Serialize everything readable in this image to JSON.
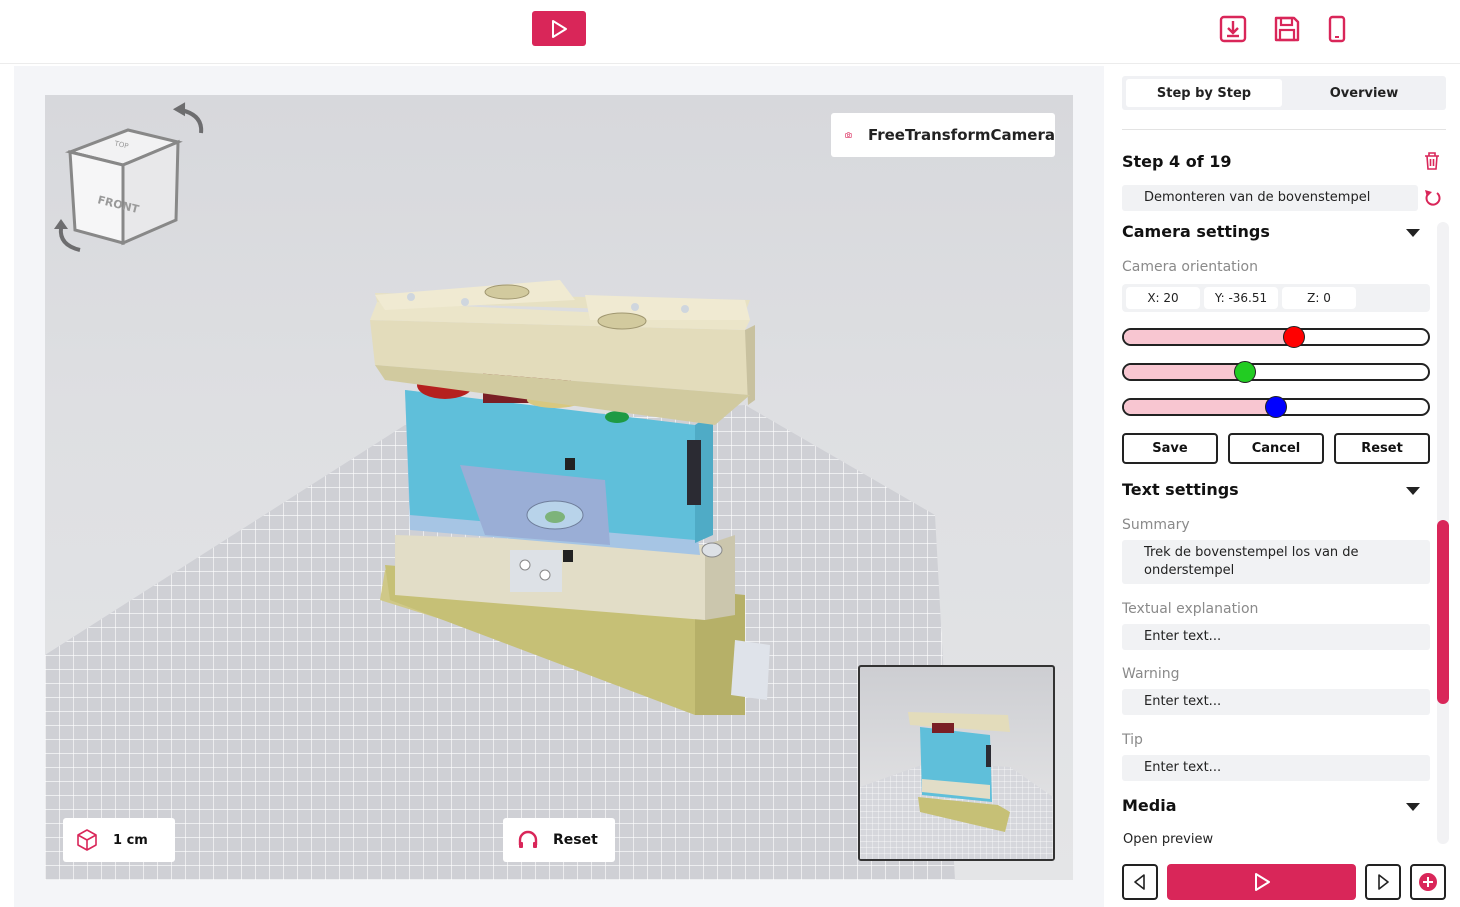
{
  "colors": {
    "accent": "#d92659",
    "slider_fill": "#f8c6d1",
    "knob_x": "#ff0000",
    "knob_y": "#22cc22",
    "knob_z": "#0000ff"
  },
  "topbar": {
    "play_icon": "play-icon",
    "download_icon": "download-icon",
    "save_icon": "save-icon",
    "mobile_icon": "mobile-icon"
  },
  "viewport": {
    "camera_label": "FreeTransformCamera",
    "camera_icon": "camera-icon",
    "view_cube_label": "FRONT",
    "view_cube_top_label": "TOP",
    "unit_label": "1 cm",
    "reset_label": "Reset"
  },
  "sidebar": {
    "tabs": [
      {
        "label": "Step by Step",
        "active": true
      },
      {
        "label": "Overview",
        "active": false
      }
    ],
    "step_title": "Step 4 of 19",
    "step_name": "Demonteren van de bovenstempel",
    "camera_settings": {
      "title": "Camera settings",
      "orientation_label": "Camera orientation",
      "x": "X: 20",
      "y": "Y: -36.51",
      "z": "Z: 0",
      "slider_x": 0.56,
      "slider_y": 0.4,
      "slider_z": 0.5,
      "save_label": "Save",
      "cancel_label": "Cancel",
      "reset_label": "Reset"
    },
    "text_settings": {
      "title": "Text settings",
      "summary_label": "Summary",
      "summary_value": "Trek de bovenstempel los van de onderstempel",
      "explanation_label": "Textual explanation",
      "explanation_placeholder": "Enter text...",
      "warning_label": "Warning",
      "warning_placeholder": "Enter text...",
      "tip_label": "Tip",
      "tip_placeholder": "Enter text..."
    },
    "media": {
      "title": "Media",
      "open_preview": "Open preview"
    }
  }
}
